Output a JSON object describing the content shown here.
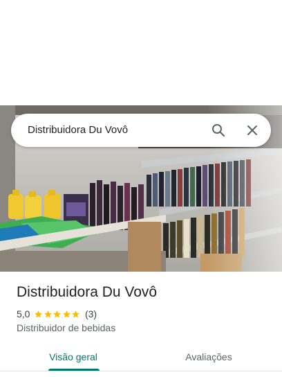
{
  "search": {
    "query": "Distribuidora Du Vovô",
    "search_icon": "search-icon",
    "close_icon": "close-icon"
  },
  "place": {
    "name": "Distribuidora Du Vovô",
    "rating": "5,0",
    "stars": 5,
    "review_count": "(3)",
    "category": "Distribuidor de bebidas",
    "photo": "store-shelves-photo"
  },
  "tabs": [
    {
      "label": "Visão geral",
      "active": true
    },
    {
      "label": "Avaliações",
      "active": false
    }
  ],
  "colors": {
    "accent": "#00796b",
    "star": "#fbbc04",
    "text_primary": "#202124",
    "text_secondary": "#5f6368"
  }
}
